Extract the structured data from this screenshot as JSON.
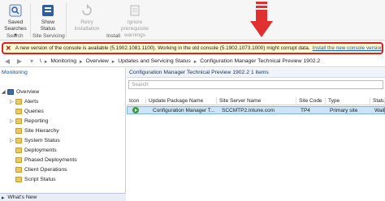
{
  "ribbon": {
    "saved_searches": "Saved Searches ▾",
    "search_group": "Search",
    "show_status": "Show Status",
    "service_group": "Site Servicing",
    "retry": "Retry installation",
    "ignore": "Ignore prerequisite warnings",
    "install_group": "Install"
  },
  "notification": {
    "message": "A new version of the console is available (5.1902.1081.1100). Working in the old console (5.1902.1073.1000) might corrupt data.",
    "link": "Install the new console version"
  },
  "breadcrumb": {
    "root": "\\",
    "items": [
      "Monitoring",
      "Overview",
      "Updates and Servicing Status",
      "Configuration Manager Technical Preview 1902.2"
    ]
  },
  "left_panel": {
    "header": "Monitoring",
    "items": [
      "Overview",
      "Alerts",
      "Queries",
      "Reporting",
      "Site Hierarchy",
      "System Status",
      "Deployments",
      "Phased Deployments",
      "Client Operations",
      "Script Status"
    ],
    "whats_new": "What's New"
  },
  "right_panel": {
    "title": "Configuration Manager Technical Preview 1902.2  1 items",
    "search_placeholder": "Search",
    "columns": [
      "Icon",
      "Update Package Name",
      "Site Server Name",
      "Site Code",
      "Type",
      "Status"
    ],
    "row": {
      "name": "Configuration Manager T...",
      "server": "SCCMTP2.Intune.com",
      "code": "TP4",
      "type": "Primary site",
      "status": "Waiti"
    }
  },
  "colors": {
    "accent": "#1a5fb4",
    "alert_border": "#d62424",
    "arrow_red": "#e03030",
    "selected_row": "#cce4f7"
  }
}
